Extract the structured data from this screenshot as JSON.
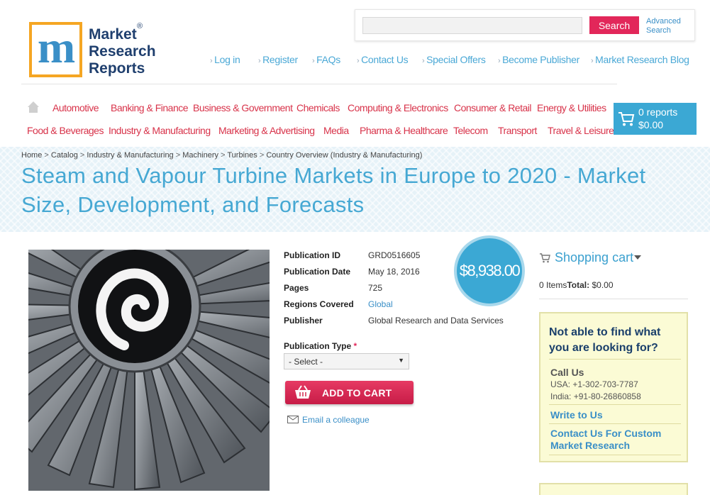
{
  "logo": {
    "mark": "m",
    "line1": "Market",
    "line2": "Research",
    "line3": "Reports",
    "registered": "®"
  },
  "search": {
    "placeholder": "",
    "button_label": "Search",
    "advanced_line1": "Advanced",
    "advanced_line2": "Search"
  },
  "top_links": [
    "Log in",
    "Register",
    "FAQs",
    "Contact Us",
    "Special Offers",
    "Become Publisher",
    "Market Research Blog"
  ],
  "categories_row1": [
    "Automotive",
    "Banking & Finance",
    "Business & Government",
    "Chemicals",
    "Computing & Electronics",
    "Consumer & Retail",
    "Energy & Utilities"
  ],
  "categories_row2": [
    "Food & Beverages",
    "Industry & Manufacturing",
    "Marketing & Advertising",
    "Media",
    "Pharma & Healthcare",
    "Telecom",
    "Transport",
    "Travel & Leisure"
  ],
  "cart_widget": {
    "count": "0 reports",
    "total": "$0.00"
  },
  "breadcrumb": [
    "Home",
    "Catalog",
    "Industry & Manufacturing",
    "Machinery",
    "Turbines",
    "Country Overview (Industry & Manufacturing)"
  ],
  "breadcrumb_separator": ">",
  "page_title": "Steam and Vapour Turbine Markets in Europe to 2020 - Market Size, Development, and Forecasts",
  "details": {
    "publication_id_label": "Publication ID",
    "publication_id": "GRD0516605",
    "publication_date_label": "Publication Date",
    "publication_date": "May 18, 2016",
    "pages_label": "Pages",
    "pages": "725",
    "regions_label": "Regions Covered",
    "regions": "Global",
    "publisher_label": "Publisher",
    "publisher": "Global Research and Data Services"
  },
  "price": "$8,938.00",
  "publication_type": {
    "label": "Publication Type",
    "required_mark": "*",
    "selected": "- Select -"
  },
  "add_to_cart_label": "ADD TO CART",
  "email_colleague_label": "Email a colleague",
  "sidebar": {
    "cart_heading": "Shopping cart",
    "items_text": "0 Items",
    "total_label": "Total:",
    "total_value": "$0.00",
    "help_title": "Not able to find what you are looking for?",
    "call_us": "Call Us",
    "phone_usa": "USA: +1-302-703-7787",
    "phone_india": "India: +91-80-26860858",
    "write_to_us": "Write to Us",
    "contact_custom": "Contact Us For Custom Market Research"
  },
  "colors": {
    "accent_blue": "#3ba8d4",
    "accent_red": "#e2275a",
    "logo_orange": "#f5a623",
    "help_box_bg": "#fbfbd5"
  },
  "icons": [
    "home-icon",
    "cart-icon",
    "basket-icon",
    "email-icon",
    "chevron-down-icon"
  ]
}
